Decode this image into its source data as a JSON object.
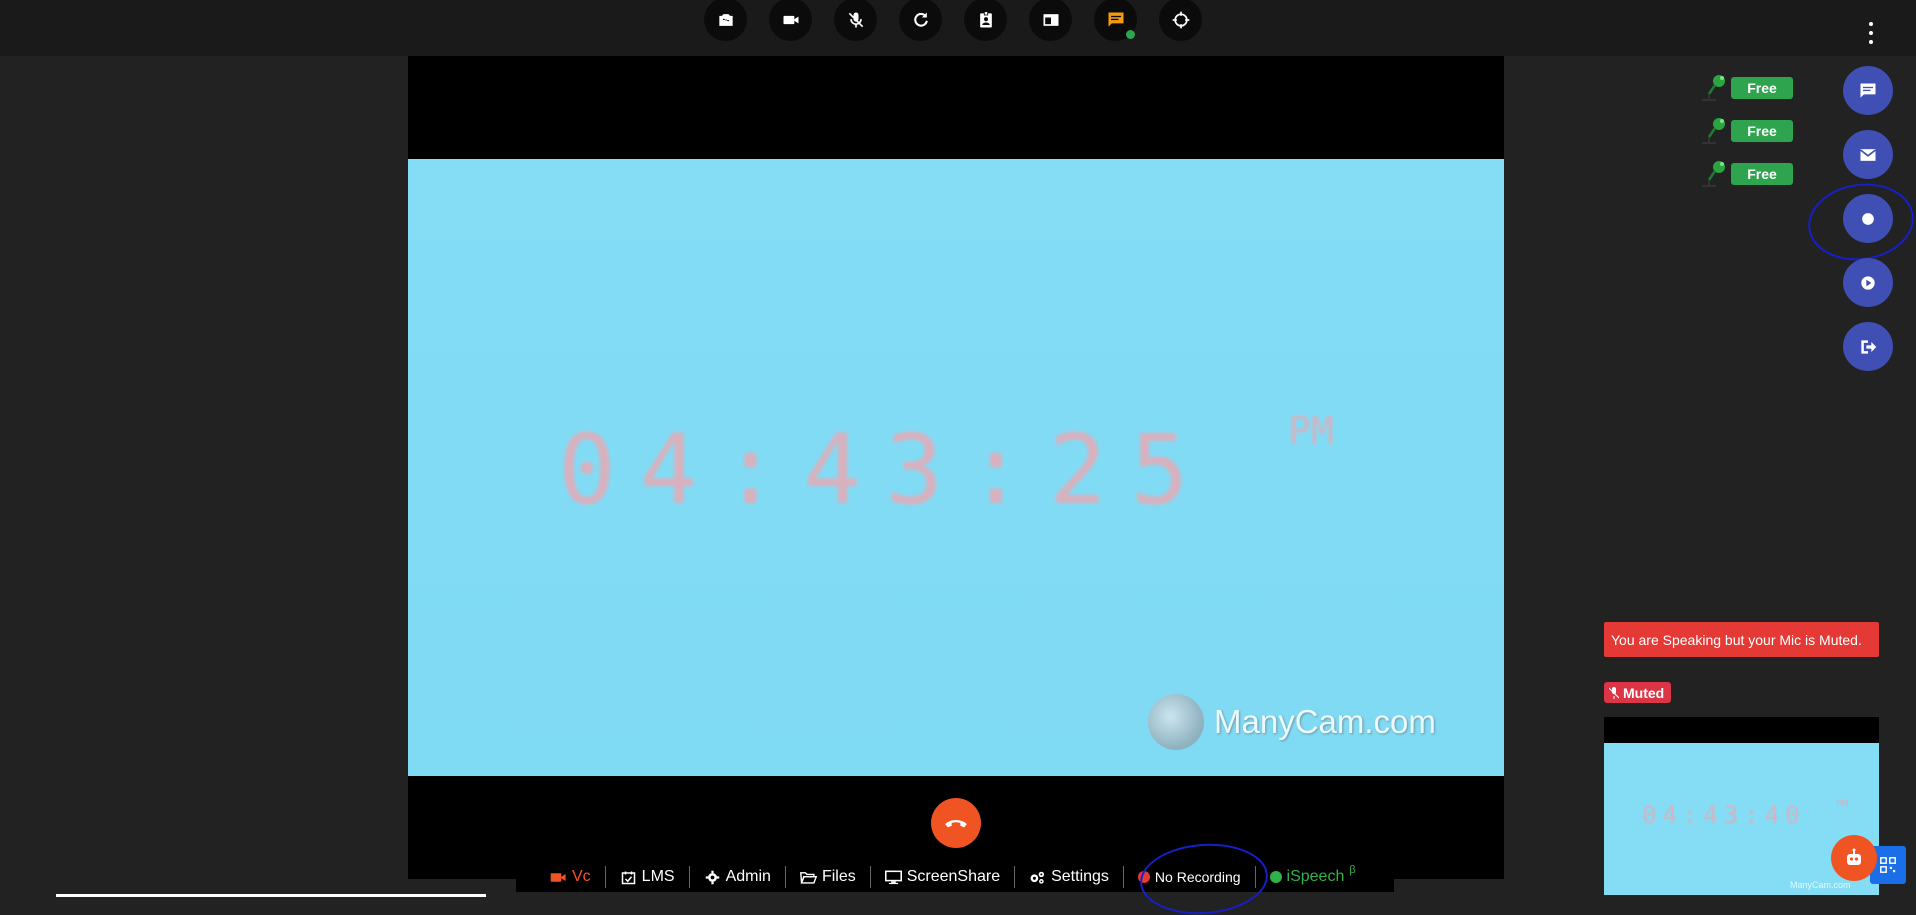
{
  "toolbar": {
    "buttons": [
      {
        "name": "switch-camera",
        "icon": "camera-switch-icon",
        "color": "#ffffff"
      },
      {
        "name": "video",
        "icon": "video-icon",
        "color": "#ffffff"
      },
      {
        "name": "mic-muted",
        "icon": "mic-off-icon",
        "color": "#ffffff"
      },
      {
        "name": "refresh",
        "icon": "refresh-icon",
        "color": "#ffffff"
      },
      {
        "name": "participants",
        "icon": "contact-badge-icon",
        "color": "#ffffff"
      },
      {
        "name": "layout",
        "icon": "layout-icon",
        "color": "#ffffff"
      },
      {
        "name": "chat",
        "icon": "chat-icon",
        "color": "#f39c12"
      },
      {
        "name": "crosshair",
        "icon": "crosshair-icon",
        "color": "#ffffff"
      }
    ],
    "chat_notification_color": "#2ea44f"
  },
  "video": {
    "clock_time": "04:43:25",
    "clock_period": "PM",
    "watermark": "ManyCam.com"
  },
  "bottom_nav": {
    "items": [
      {
        "label": "Vc",
        "icon": "video-icon"
      },
      {
        "label": "LMS",
        "icon": "calendar-check-icon"
      },
      {
        "label": "Admin",
        "icon": "gear-icon"
      },
      {
        "label": "Files",
        "icon": "folder-open-icon"
      },
      {
        "label": "ScreenShare",
        "icon": "desktop-icon"
      },
      {
        "label": "Settings",
        "icon": "gears-icon"
      },
      {
        "label": "No Recording",
        "icon": "record-dot-icon"
      },
      {
        "label": "iSpeech",
        "icon": "status-dot-icon",
        "superscript": "β"
      }
    ],
    "recording_dot_color": "#e53935",
    "ispeech_dot_color": "#2fb24a",
    "active_color": "#f05423"
  },
  "participants": [
    {
      "status": "Free"
    },
    {
      "status": "Free"
    },
    {
      "status": "Free"
    }
  ],
  "side_actions": [
    {
      "name": "chat",
      "icon": "chat-bubble-icon"
    },
    {
      "name": "mail",
      "icon": "mail-icon"
    },
    {
      "name": "record",
      "icon": "record-icon"
    },
    {
      "name": "play",
      "icon": "play-icon"
    },
    {
      "name": "exit",
      "icon": "exit-icon"
    }
  ],
  "alerts": {
    "speaking_muted": "You are Speaking but your Mic is Muted.",
    "muted_badge": "Muted"
  },
  "preview": {
    "clock_time": "04:43:40",
    "clock_period": "PM",
    "watermark": "ManyCam.com"
  },
  "colors": {
    "background": "#222222",
    "accent": "#f05423",
    "side_button": "#3f4fb3",
    "free_badge": "#2ea44f",
    "alert_red": "#e53935",
    "annotation_blue": "#1520c8"
  }
}
